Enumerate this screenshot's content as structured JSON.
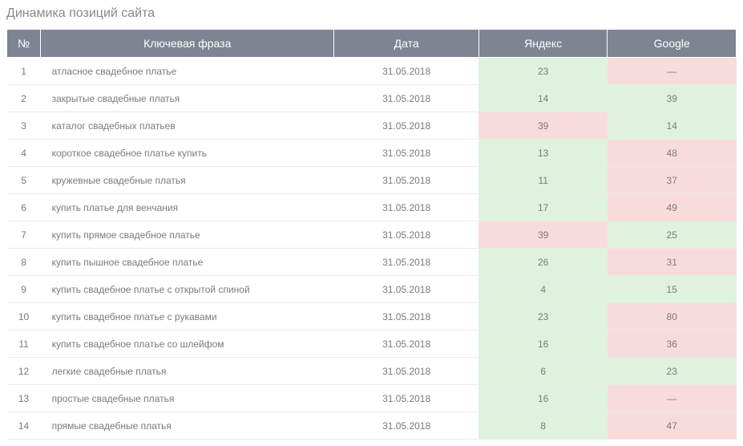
{
  "title": "Динамика позиций сайта",
  "headers": {
    "num": "№",
    "key": "Ключевая фраза",
    "date": "Дата",
    "yandex": "Яндекс",
    "google": "Google"
  },
  "rows": [
    {
      "num": "1",
      "key": "атласное свадебное платье",
      "date": "31.05.2018",
      "yandex": "23",
      "yandex_color": "green",
      "google": "—",
      "google_color": "red"
    },
    {
      "num": "2",
      "key": "закрытые свадебные платья",
      "date": "31.05.2018",
      "yandex": "14",
      "yandex_color": "green",
      "google": "39",
      "google_color": "green"
    },
    {
      "num": "3",
      "key": "каталог свадебных платьев",
      "date": "31.05.2018",
      "yandex": "39",
      "yandex_color": "red",
      "google": "14",
      "google_color": "green"
    },
    {
      "num": "4",
      "key": "короткое свадебное платье купить",
      "date": "31.05.2018",
      "yandex": "13",
      "yandex_color": "green",
      "google": "48",
      "google_color": "red"
    },
    {
      "num": "5",
      "key": "кружевные свадебные платья",
      "date": "31.05.2018",
      "yandex": "11",
      "yandex_color": "green",
      "google": "37",
      "google_color": "red"
    },
    {
      "num": "6",
      "key": "купить платье для венчания",
      "date": "31.05.2018",
      "yandex": "17",
      "yandex_color": "green",
      "google": "49",
      "google_color": "red"
    },
    {
      "num": "7",
      "key": "купить прямое свадебное платье",
      "date": "31.05.2018",
      "yandex": "39",
      "yandex_color": "red",
      "google": "25",
      "google_color": "green"
    },
    {
      "num": "8",
      "key": "купить пышное свадебное платье",
      "date": "31.05.2018",
      "yandex": "26",
      "yandex_color": "green",
      "google": "31",
      "google_color": "red"
    },
    {
      "num": "9",
      "key": "купить свадебное платье с открытой спиной",
      "date": "31.05.2018",
      "yandex": "4",
      "yandex_color": "green",
      "google": "15",
      "google_color": "green"
    },
    {
      "num": "10",
      "key": "купить свадебное платье с рукавами",
      "date": "31.05.2018",
      "yandex": "23",
      "yandex_color": "green",
      "google": "80",
      "google_color": "red"
    },
    {
      "num": "11",
      "key": "купить свадебное платье со шлейфом",
      "date": "31.05.2018",
      "yandex": "16",
      "yandex_color": "green",
      "google": "36",
      "google_color": "red"
    },
    {
      "num": "12",
      "key": "легкие свадебные платья",
      "date": "31.05.2018",
      "yandex": "6",
      "yandex_color": "green",
      "google": "23",
      "google_color": "green"
    },
    {
      "num": "13",
      "key": "простые свадебные платья",
      "date": "31.05.2018",
      "yandex": "16",
      "yandex_color": "green",
      "google": "—",
      "google_color": "red"
    },
    {
      "num": "14",
      "key": "прямые свадебные платья",
      "date": "31.05.2018",
      "yandex": "8",
      "yandex_color": "green",
      "google": "47",
      "google_color": "red"
    }
  ]
}
